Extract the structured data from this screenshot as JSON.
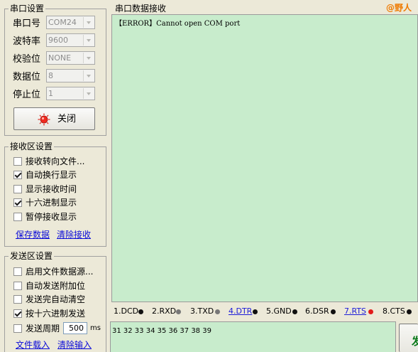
{
  "port_settings": {
    "title": "串口设置",
    "port_label": "串口号",
    "port_value": "COM24",
    "baud_label": "波特率",
    "baud_value": "9600",
    "parity_label": "校验位",
    "parity_value": "NONE",
    "databits_label": "数据位",
    "databits_value": "8",
    "stopbits_label": "停止位",
    "stopbits_value": "1",
    "open_close_label": "关闭"
  },
  "receive_settings": {
    "title": "接收区设置",
    "options": [
      {
        "label": "接收转向文件...",
        "checked": false
      },
      {
        "label": "自动换行显示",
        "checked": true
      },
      {
        "label": "显示接收时间",
        "checked": false
      },
      {
        "label": "十六进制显示",
        "checked": true
      },
      {
        "label": "暂停接收显示",
        "checked": false
      }
    ],
    "save_link": "保存数据",
    "clear_link": "清除接收"
  },
  "send_settings": {
    "title": "发送区设置",
    "options": [
      {
        "label": "启用文件数据源...",
        "checked": false
      },
      {
        "label": "自动发送附加位",
        "checked": false
      },
      {
        "label": "发送完自动清空",
        "checked": false
      },
      {
        "label": "按十六进制发送",
        "checked": true
      }
    ],
    "period_label": "发送周期",
    "period_value": "500",
    "period_unit": "ms",
    "load_link": "文件载入",
    "clear_link": "清除输入"
  },
  "receive_area": {
    "title": "串口数据接收",
    "brand": "@野人",
    "text": "【ERROR】Cannot open COM port"
  },
  "status_pins": [
    {
      "label": "1.DCD",
      "link": false,
      "color": "#111111"
    },
    {
      "label": "2.RXD",
      "link": false,
      "color": "#777777"
    },
    {
      "label": "3.TXD",
      "link": false,
      "color": "#777777"
    },
    {
      "label": "4.DTR",
      "link": true,
      "color": "#111111"
    },
    {
      "label": "5.GND",
      "link": false,
      "color": "#111111"
    },
    {
      "label": "6.DSR",
      "link": false,
      "color": "#111111"
    },
    {
      "label": "7.RTS",
      "link": true,
      "color": "#e21b1b"
    },
    {
      "label": "8.CTS",
      "link": false,
      "color": "#111111"
    }
  ],
  "send_area": {
    "text": "31 32 33 34 35 36 37 38 39",
    "send_button_label": "发"
  },
  "colors": {
    "area_bg": "#c8eccc",
    "brand": "#ef7a00",
    "link": "#0a0ad8"
  }
}
